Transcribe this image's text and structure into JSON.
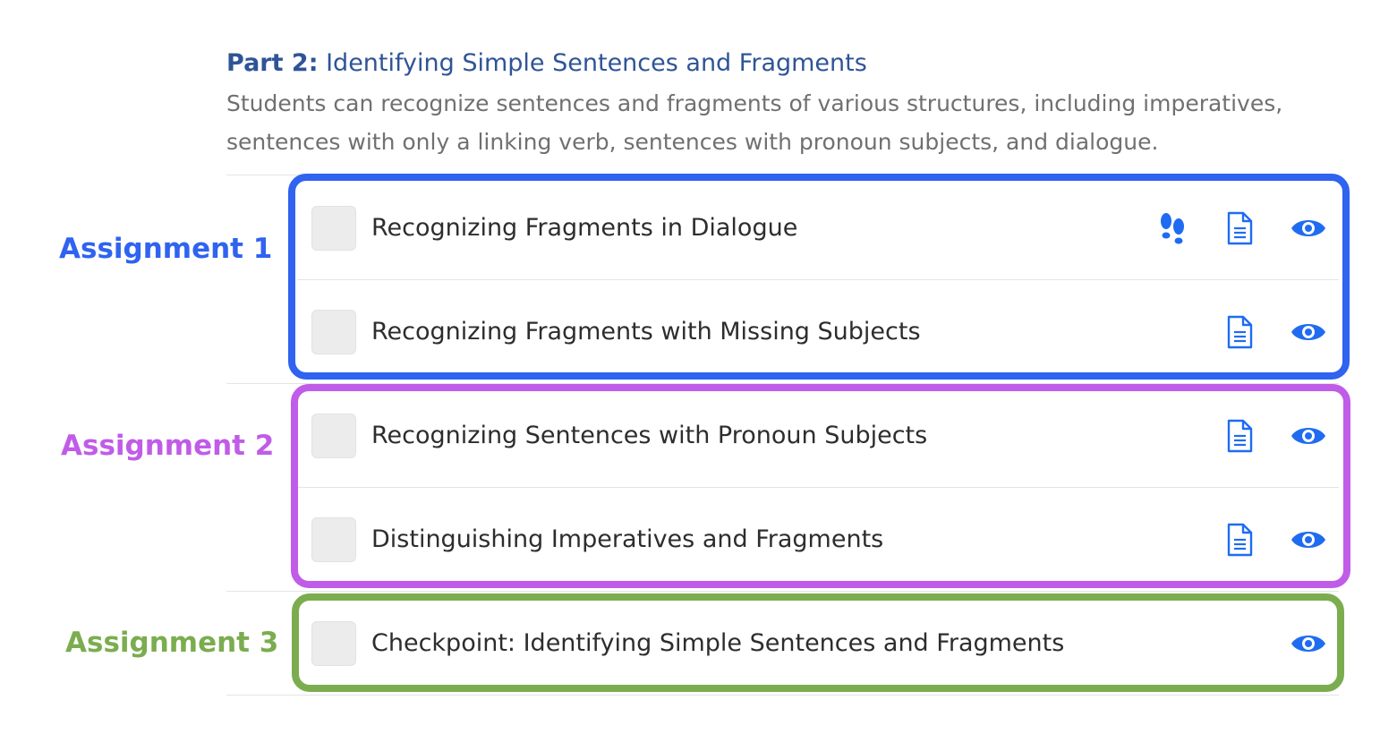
{
  "section": {
    "title_prefix": "Part 2:",
    "title": "Identifying Simple Sentences and Fragments",
    "description": "Students can recognize sentences and fragments of various structures, including imperatives, sentences with only a linking verb, sentences with pronoun subjects, and dialogue."
  },
  "groups": [
    {
      "label": "Assignment 1",
      "color": "#2f63f0"
    },
    {
      "label": "Assignment 2",
      "color": "#c05ce8"
    },
    {
      "label": "Assignment 3",
      "color": "#7bad4f"
    }
  ],
  "colors": {
    "icon": "#1f6cf2",
    "title": "#2f5496"
  },
  "items": [
    {
      "label": "Recognizing Fragments in Dialogue",
      "icons": [
        "steps-icon",
        "document-icon",
        "eye-icon"
      ]
    },
    {
      "label": "Recognizing Fragments with Missing Subjects",
      "icons": [
        "document-icon",
        "eye-icon"
      ]
    },
    {
      "label": "Recognizing Sentences with Pronoun Subjects",
      "icons": [
        "document-icon",
        "eye-icon"
      ]
    },
    {
      "label": "Distinguishing Imperatives and Fragments",
      "icons": [
        "document-icon",
        "eye-icon"
      ]
    },
    {
      "label": "Checkpoint: Identifying Simple Sentences and Fragments",
      "icons": [
        "eye-icon"
      ]
    }
  ]
}
